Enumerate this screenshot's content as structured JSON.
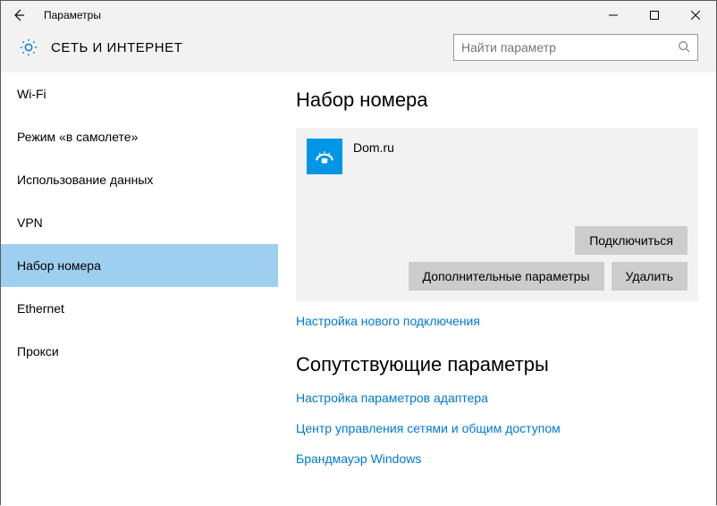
{
  "titlebar": {
    "title": "Параметры"
  },
  "header": {
    "category": "СЕТЬ И ИНТЕРНЕТ",
    "search_placeholder": "Найти параметр"
  },
  "sidebar": {
    "items": [
      {
        "label": "Wi-Fi"
      },
      {
        "label": "Режим «в самолете»"
      },
      {
        "label": "Использование данных"
      },
      {
        "label": "VPN"
      },
      {
        "label": "Набор номера"
      },
      {
        "label": "Ethernet"
      },
      {
        "label": "Прокси"
      }
    ],
    "active_index": 4
  },
  "main": {
    "section1_title": "Набор номера",
    "connection": {
      "name": "Dom.ru",
      "connect_btn": "Подключиться",
      "advanced_btn": "Дополнительные параметры",
      "delete_btn": "Удалить"
    },
    "new_connection_link": "Настройка нового подключения",
    "section2_title": "Сопутствующие параметры",
    "related_links": [
      "Настройка параметров адаптера",
      "Центр управления сетями и общим доступом",
      "Брандмауэр Windows"
    ]
  }
}
